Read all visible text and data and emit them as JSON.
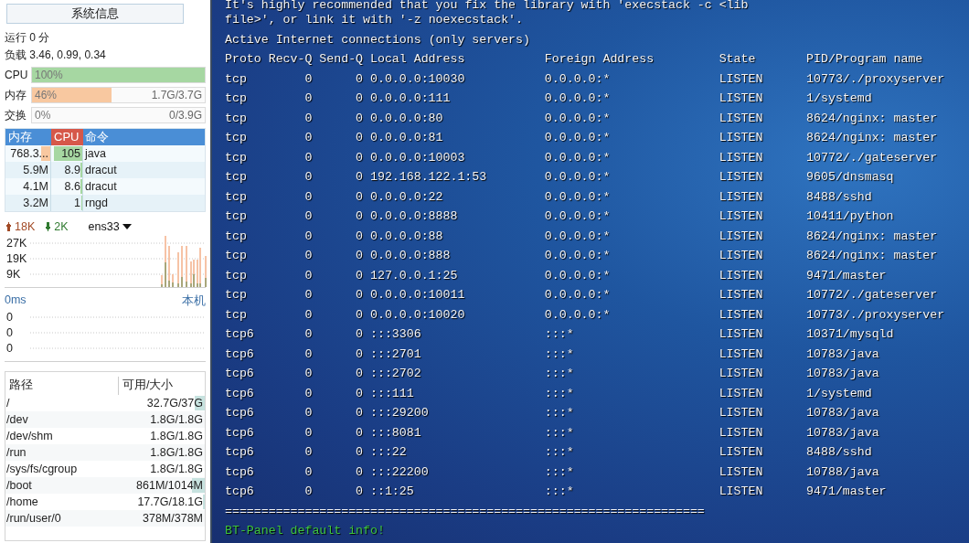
{
  "sidebar": {
    "title_button": "系统信息",
    "uptime": "运行 0 分",
    "load": "负载 3.46, 0.99, 0.34",
    "meters": [
      {
        "label": "CPU",
        "value": "100%",
        "level": 1.0,
        "color": "#a6d7a2"
      },
      {
        "label": "内存",
        "value": "46%",
        "detail": "1.7G/3.7G",
        "level": 0.46,
        "color": "#f8c8a0"
      },
      {
        "label": "交换",
        "value": "0%",
        "detail": "0/3.9G"
      }
    ],
    "process_table": {
      "columns": [
        {
          "label": "内存",
          "selected": false
        },
        {
          "label": "CPU",
          "selected": true
        },
        {
          "label": "命令",
          "selected": false
        }
      ],
      "rows": [
        {
          "memory": {
            "text": "768.3...",
            "level": 0.2
          },
          "cpu": {
            "text": "105",
            "level": 0.9
          },
          "command": "java"
        },
        {
          "memory": {
            "text": "5.9M"
          },
          "cpu": {
            "text": "8.9",
            "level": 0.05
          },
          "command": "dracut"
        },
        {
          "memory": {
            "text": "4.1M"
          },
          "cpu": {
            "text": "8.6",
            "level": 0.05
          },
          "command": "dracut"
        },
        {
          "memory": {
            "text": "3.2M"
          },
          "cpu": {
            "text": "1",
            "level": 0.02
          },
          "command": "rngd"
        }
      ]
    },
    "network": {
      "upload": "18K",
      "download": "2K",
      "interface": "ens33",
      "y_labels": [
        "27K",
        "19K",
        "9K"
      ]
    },
    "latency": {
      "value": "0ms",
      "host": "本机",
      "y_labels": [
        "0",
        "0",
        "0"
      ]
    },
    "disks": {
      "columns": [
        "路径",
        "可用/大小"
      ],
      "rows": [
        {
          "path": "/",
          "space": "32.7G/37G",
          "level": 0.12
        },
        {
          "path": "/dev",
          "space": "1.8G/1.8G"
        },
        {
          "path": "/dev/shm",
          "space": "1.8G/1.8G"
        },
        {
          "path": "/run",
          "space": "1.8G/1.8G"
        },
        {
          "path": "/sys/fs/cgroup",
          "space": "1.8G/1.8G"
        },
        {
          "path": "/boot",
          "space": "861M/1014M",
          "level": 0.15
        },
        {
          "path": "/home",
          "space": "17.7G/18.1G",
          "level": 0.02
        },
        {
          "path": "/run/user/0",
          "space": "378M/378M"
        }
      ]
    }
  },
  "terminal": {
    "lines": [
      "It's highly recommended that you fix the library with 'execstack -c <lib",
      "file>', or link it with '-z noexecstack'.",
      "Active Internet connections (only servers)"
    ],
    "columns": [
      "Proto",
      "Recv-Q",
      "Send-Q",
      "Local Address",
      "Foreign Address",
      "State",
      "PID/Program name"
    ],
    "rows": [
      [
        "tcp",
        "0",
        "0",
        "0.0.0.0:10030",
        "0.0.0.0:*",
        "LISTEN",
        "10773/./proxyserver"
      ],
      [
        "tcp",
        "0",
        "0",
        "0.0.0.0:111",
        "0.0.0.0:*",
        "LISTEN",
        "1/systemd"
      ],
      [
        "tcp",
        "0",
        "0",
        "0.0.0.0:80",
        "0.0.0.0:*",
        "LISTEN",
        "8624/nginx: master"
      ],
      [
        "tcp",
        "0",
        "0",
        "0.0.0.0:81",
        "0.0.0.0:*",
        "LISTEN",
        "8624/nginx: master"
      ],
      [
        "tcp",
        "0",
        "0",
        "0.0.0.0:10003",
        "0.0.0.0:*",
        "LISTEN",
        "10772/./gateserver"
      ],
      [
        "tcp",
        "0",
        "0",
        "192.168.122.1:53",
        "0.0.0.0:*",
        "LISTEN",
        "9605/dnsmasq"
      ],
      [
        "tcp",
        "0",
        "0",
        "0.0.0.0:22",
        "0.0.0.0:*",
        "LISTEN",
        "8488/sshd"
      ],
      [
        "tcp",
        "0",
        "0",
        "0.0.0.0:8888",
        "0.0.0.0:*",
        "LISTEN",
        "10411/python"
      ],
      [
        "tcp",
        "0",
        "0",
        "0.0.0.0:88",
        "0.0.0.0:*",
        "LISTEN",
        "8624/nginx: master"
      ],
      [
        "tcp",
        "0",
        "0",
        "0.0.0.0:888",
        "0.0.0.0:*",
        "LISTEN",
        "8624/nginx: master"
      ],
      [
        "tcp",
        "0",
        "0",
        "127.0.0.1:25",
        "0.0.0.0:*",
        "LISTEN",
        "9471/master"
      ],
      [
        "tcp",
        "0",
        "0",
        "0.0.0.0:10011",
        "0.0.0.0:*",
        "LISTEN",
        "10772/./gateserver"
      ],
      [
        "tcp",
        "0",
        "0",
        "0.0.0.0:10020",
        "0.0.0.0:*",
        "LISTEN",
        "10773/./proxyserver"
      ],
      [
        "tcp6",
        "0",
        "0",
        ":::3306",
        ":::*",
        "LISTEN",
        "10371/mysqld"
      ],
      [
        "tcp6",
        "0",
        "0",
        ":::2701",
        ":::*",
        "LISTEN",
        "10783/java"
      ],
      [
        "tcp6",
        "0",
        "0",
        ":::2702",
        ":::*",
        "LISTEN",
        "10783/java"
      ],
      [
        "tcp6",
        "0",
        "0",
        ":::111",
        ":::*",
        "LISTEN",
        "1/systemd"
      ],
      [
        "tcp6",
        "0",
        "0",
        ":::29200",
        ":::*",
        "LISTEN",
        "10783/java"
      ],
      [
        "tcp6",
        "0",
        "0",
        ":::8081",
        ":::*",
        "LISTEN",
        "10783/java"
      ],
      [
        "tcp6",
        "0",
        "0",
        ":::22",
        ":::*",
        "LISTEN",
        "8488/sshd"
      ],
      [
        "tcp6",
        "0",
        "0",
        ":::22200",
        ":::*",
        "LISTEN",
        "10788/java"
      ],
      [
        "tcp6",
        "0",
        "0",
        "::1:25",
        ":::*",
        "LISTEN",
        "9471/master"
      ]
    ],
    "separator": "==================================================================",
    "footer": "BT-Panel default info!"
  }
}
